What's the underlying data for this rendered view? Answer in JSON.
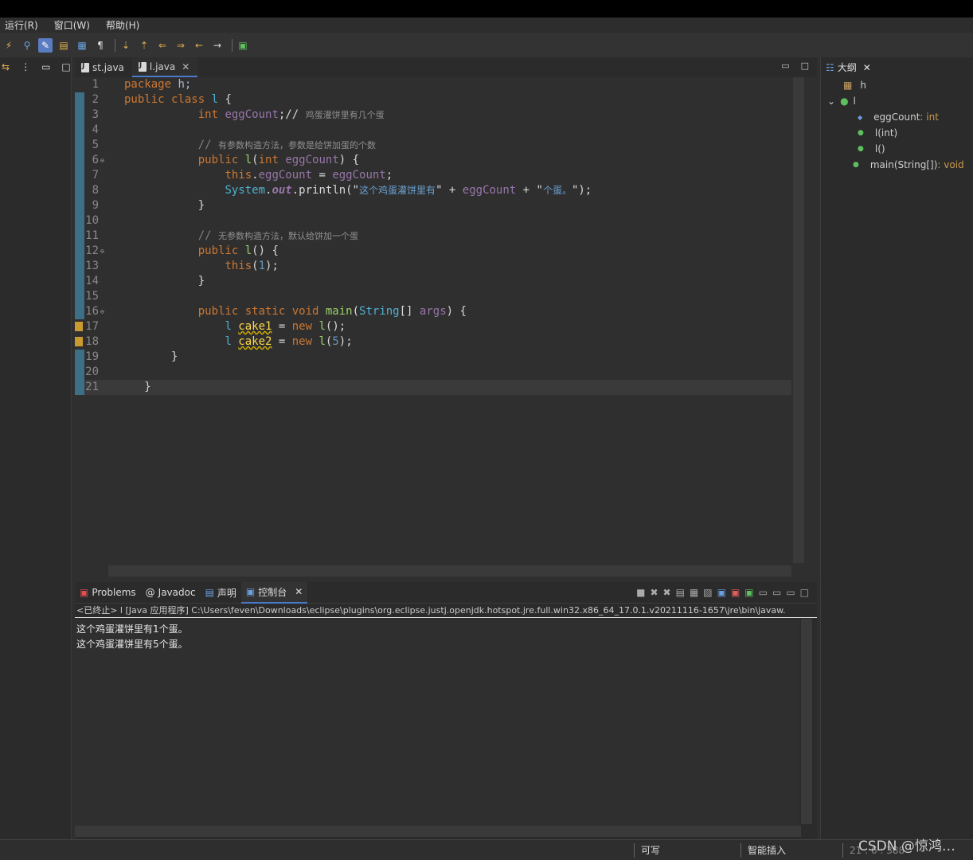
{
  "menus": [
    "运行(R)",
    "窗口(W)",
    "帮助(H)"
  ],
  "editor": {
    "tabs": [
      {
        "label": "st.java"
      },
      {
        "label": "l.java"
      }
    ]
  },
  "code_lines": [
    {
      "n": "1",
      "tokens": [
        [
          "kw",
          "package "
        ],
        [
          "id",
          "h;"
        ]
      ]
    },
    {
      "n": "2",
      "tokens": [
        [
          "kw",
          "public class "
        ],
        [
          "cls",
          "l "
        ],
        [
          "pl",
          "{"
        ]
      ]
    },
    {
      "n": "3",
      "tokens": [
        [
          "pl",
          "           "
        ],
        [
          "kw",
          "int "
        ],
        [
          "fld",
          "eggCount"
        ],
        [
          "pl",
          ";// "
        ],
        [
          "cjk",
          "鸡蛋灌饼里有几个蛋"
        ]
      ]
    },
    {
      "n": "4",
      "tokens": []
    },
    {
      "n": "5",
      "tokens": [
        [
          "pl",
          "           "
        ],
        [
          "cm",
          "// "
        ],
        [
          "cjk",
          "有参数构造方法，参数是给饼加蛋的个数"
        ]
      ]
    },
    {
      "n": "6",
      "fold": true,
      "tokens": [
        [
          "pl",
          "           "
        ],
        [
          "kw",
          "public "
        ],
        [
          "green",
          "l"
        ],
        [
          "pl",
          "("
        ],
        [
          "kw",
          "int "
        ],
        [
          "fld",
          "eggCount"
        ],
        [
          "pl",
          ") {"
        ]
      ]
    },
    {
      "n": "7",
      "tokens": [
        [
          "pl",
          "               "
        ],
        [
          "kw",
          "this"
        ],
        [
          "pl",
          "."
        ],
        [
          "fld",
          "eggCount"
        ],
        [
          "pl",
          " = "
        ],
        [
          "fld",
          "eggCount"
        ],
        [
          "pl",
          ";"
        ]
      ]
    },
    {
      "n": "8",
      "tokens": [
        [
          "pl",
          "               "
        ],
        [
          "cls",
          "System"
        ],
        [
          "pl",
          "."
        ],
        [
          "out",
          "out"
        ],
        [
          "pl",
          ".println(\""
        ],
        [
          "scjk",
          "这个鸡蛋灌饼里有"
        ],
        [
          "pl",
          "\" + "
        ],
        [
          "fld",
          "eggCount"
        ],
        [
          "pl",
          " + \""
        ],
        [
          "scjk",
          "个蛋。"
        ],
        [
          "pl",
          "\");"
        ]
      ]
    },
    {
      "n": "9",
      "tokens": [
        [
          "pl",
          "           }"
        ]
      ]
    },
    {
      "n": "10",
      "tokens": []
    },
    {
      "n": "11",
      "tokens": [
        [
          "pl",
          "           "
        ],
        [
          "cm",
          "// "
        ],
        [
          "cjk",
          "无参数构造方法，默认给饼加一个蛋"
        ]
      ]
    },
    {
      "n": "12",
      "fold": true,
      "tokens": [
        [
          "pl",
          "           "
        ],
        [
          "kw",
          "public "
        ],
        [
          "green",
          "l"
        ],
        [
          "pl",
          "() {"
        ]
      ]
    },
    {
      "n": "13",
      "tokens": [
        [
          "pl",
          "               "
        ],
        [
          "kw",
          "this"
        ],
        [
          "pl",
          "("
        ],
        [
          "num",
          "1"
        ],
        [
          "pl",
          ");"
        ]
      ]
    },
    {
      "n": "14",
      "tokens": [
        [
          "pl",
          "           }"
        ]
      ]
    },
    {
      "n": "15",
      "tokens": []
    },
    {
      "n": "16",
      "fold": true,
      "tokens": [
        [
          "pl",
          "           "
        ],
        [
          "kw",
          "public static void "
        ],
        [
          "green",
          "main"
        ],
        [
          "pl",
          "("
        ],
        [
          "cls",
          "String"
        ],
        [
          "pl",
          "[] "
        ],
        [
          "fld",
          "args"
        ],
        [
          "pl",
          ") {"
        ]
      ]
    },
    {
      "n": "17",
      "warn": true,
      "tokens": [
        [
          "pl",
          "               "
        ],
        [
          "cls",
          "l "
        ],
        [
          "warn",
          "cake1"
        ],
        [
          "pl",
          " = "
        ],
        [
          "kw",
          "new "
        ],
        [
          "green",
          "l"
        ],
        [
          "pl",
          "();"
        ]
      ]
    },
    {
      "n": "18",
      "warn": true,
      "tokens": [
        [
          "pl",
          "               "
        ],
        [
          "cls",
          "l "
        ],
        [
          "warn",
          "cake2"
        ],
        [
          "pl",
          " = "
        ],
        [
          "kw",
          "new "
        ],
        [
          "green",
          "l"
        ],
        [
          "pl",
          "("
        ],
        [
          "num",
          "5"
        ],
        [
          "pl",
          ");"
        ]
      ]
    },
    {
      "n": "19",
      "tokens": [
        [
          "pl",
          "       }"
        ]
      ]
    },
    {
      "n": "20",
      "tokens": []
    },
    {
      "n": "21",
      "cur": true,
      "tokens": [
        [
          "pl",
          "   }"
        ]
      ]
    }
  ],
  "outline": {
    "title": "大纲",
    "package": "h",
    "class": "l",
    "items": [
      {
        "label": "eggCount",
        "type": " : int"
      },
      {
        "label": "l(int)",
        "type": ""
      },
      {
        "label": "l()",
        "type": ""
      },
      {
        "label": "main(String[])",
        "type": " : void"
      }
    ]
  },
  "console": {
    "tabs": [
      "Problems",
      "Javadoc",
      "声明",
      "控制台"
    ],
    "path": "<已终止> l [Java 应用程序] C:\\Users\\feven\\Downloads\\eclipse\\plugins\\org.eclipse.justj.openjdk.hotspot.jre.full.win32.x86_64_17.0.1.v20211116-1657\\jre\\bin\\javaw.",
    "output": [
      "这个鸡蛋灌饼里有1个蛋。",
      "这个鸡蛋灌饼里有5个蛋。"
    ]
  },
  "status": {
    "writable": "可写",
    "insert_mode": "智能插入",
    "position": "21 : 6 : 388"
  },
  "watermark": "CSDN @惊鸿…"
}
